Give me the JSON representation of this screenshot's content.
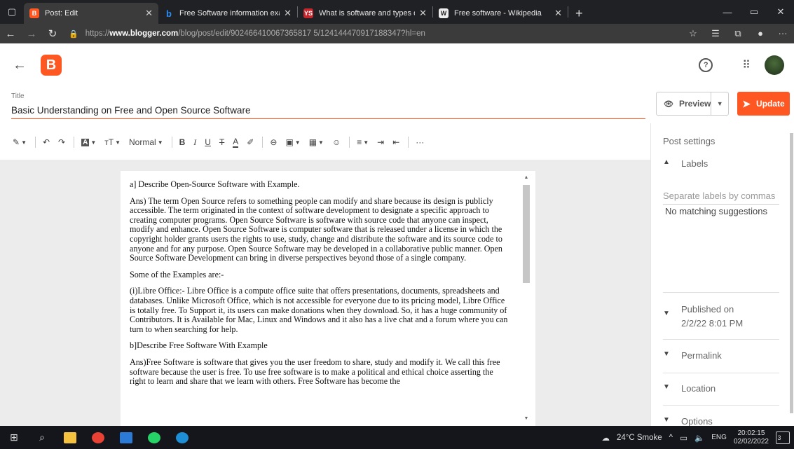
{
  "browser": {
    "tabs": [
      {
        "label": "Post: Edit",
        "favicon": "B",
        "favicon_color": "#ff5722",
        "active": true
      },
      {
        "label": "Free Software information examp",
        "favicon": "b",
        "favicon_color": "#0a84ff",
        "active": false
      },
      {
        "label": "What is software and types of sc",
        "favicon": "YS",
        "favicon_color": "#c4262e",
        "active": false
      },
      {
        "label": "Free software - Wikipedia",
        "favicon": "W",
        "favicon_color": "#555555",
        "active": false
      }
    ],
    "url_prefix": "https://",
    "url_domain": "www.blogger.com",
    "url_path": "/blog/post/edit/902466410067365817 5/124144470917188347?hl=en"
  },
  "editor": {
    "title_label": "Title",
    "title_value": "Basic Understanding on Free and Open Source Software",
    "preview_label": "Preview",
    "update_label": "Update",
    "format_label": "Normal",
    "paragraphs": [
      "a] Describe Open-Source Software with Example.",
      "Ans) The term Open Source refers to something people can modify and share because its design is publicly accessible. The term originated in the context of software development to designate a specific approach to creating computer programs. Open Source Software is software with source code that anyone can inspect, modify and enhance. Open Source Software is computer software that is released under a license in which the copyright holder grants users the rights to use, study, change and distribute the software and its source code to anyone and for any purpose. Open Source Software may be developed in a collaborative public manner. Open Source Software Development can bring in diverse perspectives beyond those of a single company.",
      "Some of the Examples are:-",
      "(i)Libre Office:- Libre Office is a compute office suite that offers presentations, documents, spreadsheets and databases. Unlike Microsoft Office, which is not accessible for everyone due to its pricing model, Libre Office is totally free. To Support it, its users can make donations when they download. So, it has a huge community of Contributors. It is Available for Mac, Linux and Windows and it also has a live chat and a forum where you can turn to when searching for help.",
      "b]Describe Free Software With Example",
      "Ans)Free Software is software that gives you the user freedom to share, study and modify it. We call this free software because the user is free. To use free software is to make a political and ethical choice asserting the right to learn and share that we learn with others. Free Software has become the"
    ]
  },
  "sidebar": {
    "title": "Post settings",
    "labels_heading": "Labels",
    "labels_placeholder": "Separate labels by commas",
    "labels_suggestion": "No matching suggestions",
    "published_label": "Published on",
    "published_value": "2/2/22 8:01 PM",
    "permalink_label": "Permalink",
    "location_label": "Location",
    "options_label": "Options"
  },
  "taskbar": {
    "weather": "24°C  Smoke",
    "language": "ENG",
    "time": "20:02:15",
    "date": "02/02/2022",
    "notifications": "3"
  },
  "colors": {
    "accent": "#ff5722"
  }
}
